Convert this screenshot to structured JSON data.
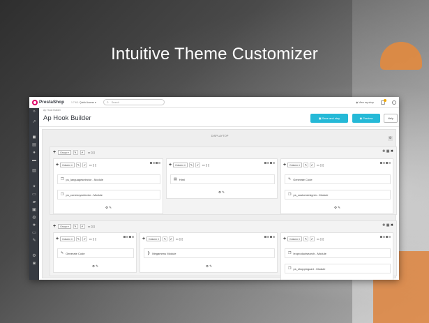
{
  "headline": "Intuitive Theme Customizer",
  "topbar": {
    "logo": "PrestaShop",
    "version": "1.7.6.1",
    "quick_access": "Quick Access ▾",
    "search_placeholder": "Search",
    "view_shop": "View my shop"
  },
  "header": {
    "breadcrumb": "Ap Hook Builder",
    "title": "Ap Hook Builder",
    "save_label": "Save and stay",
    "preview_label": "Preview",
    "help_label": "Help"
  },
  "hook": {
    "name": "DISPLAYTOP"
  },
  "tools": {
    "group_label": "Group ▾",
    "column_label": "Column ▾",
    "plus": "+",
    "edit": "✎",
    "check": "✔",
    "devices": "▭ ▯ ▯",
    "row_icons": "✚ ▦ ✖",
    "foot_icons": "⚙ ✎"
  },
  "groups": [
    {
      "columns": [
        {
          "widgets": [
            "ps_languageselector - Module",
            "ps_currencyselector - Module"
          ]
        },
        {
          "widgets": [
            "Html"
          ]
        },
        {
          "widgets": [
            "Generate Code",
            "ps_customersignin - Module"
          ]
        }
      ]
    },
    {
      "columns": [
        {
          "widgets": [
            "Generate Code"
          ]
        },
        {
          "widgets": [
            "Megamenu Module"
          ]
        },
        {
          "widgets": [
            "leoproductsearch - Module",
            "ps_shoppingcart - Module"
          ]
        }
      ]
    }
  ],
  "colors": {
    "accent": "#25b9d7",
    "sidebar": "#363a41",
    "brand": "#df0067"
  },
  "icons": [
    "search-icon",
    "eye-icon",
    "bell-icon",
    "user-icon",
    "gear-icon",
    "pencil-icon",
    "check-icon",
    "plus-icon",
    "module-icon",
    "html-icon",
    "code-icon",
    "chevron-right-icon"
  ]
}
